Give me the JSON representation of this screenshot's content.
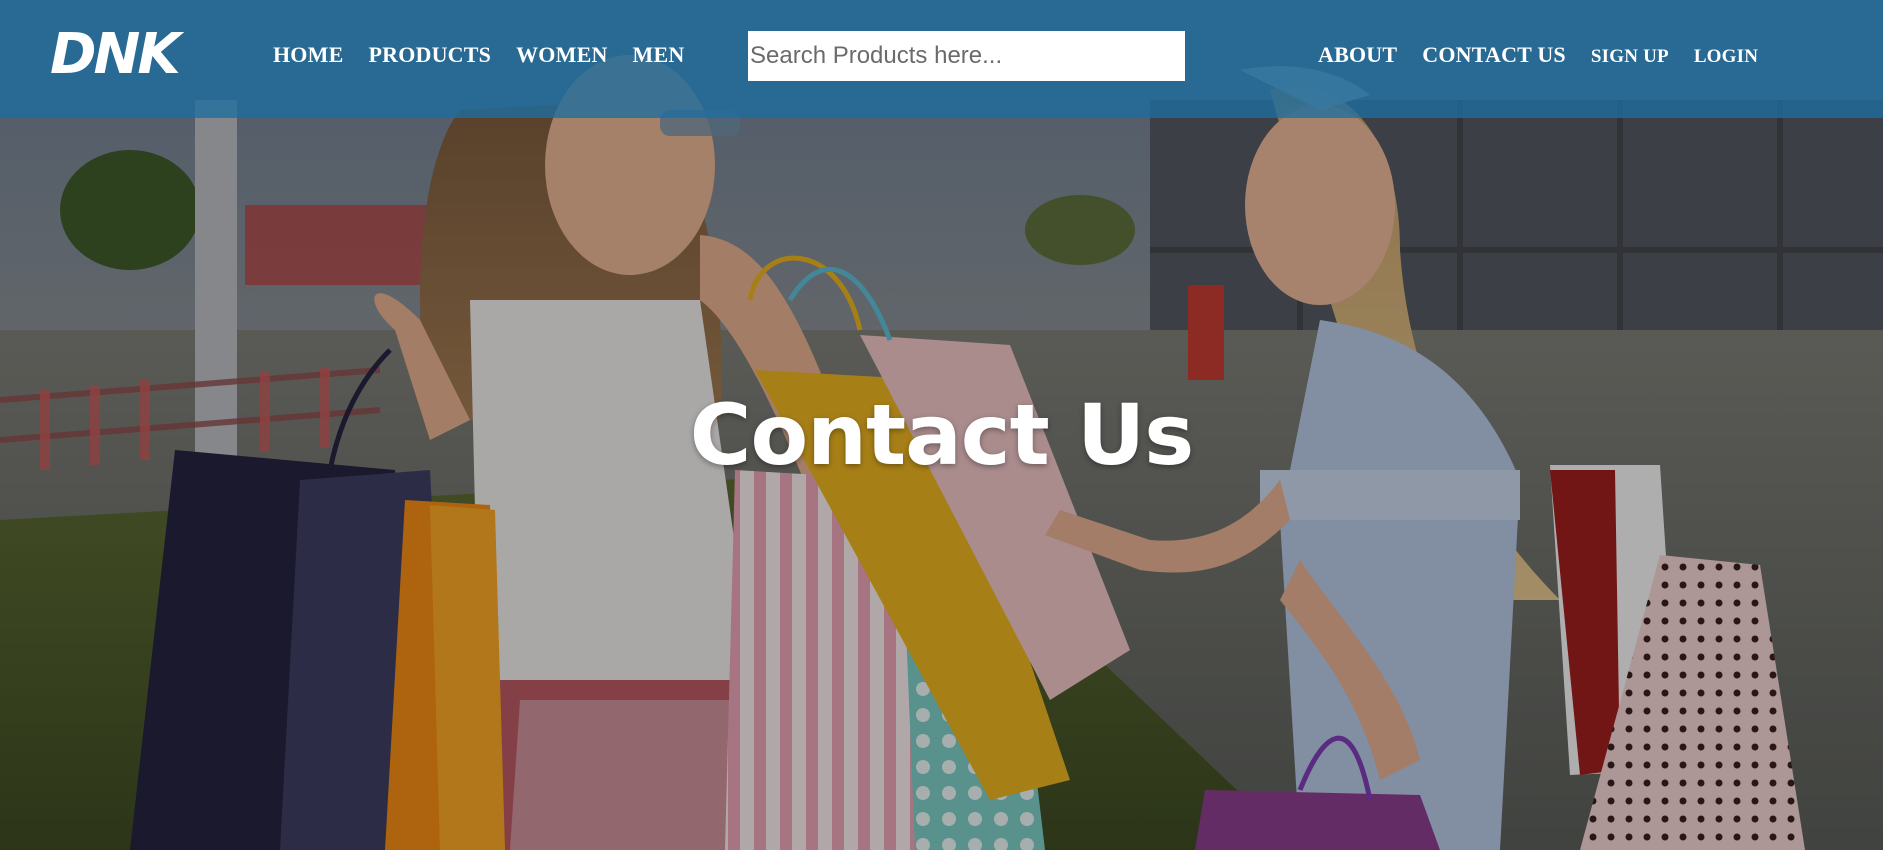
{
  "brand": {
    "logo_text": "DNK"
  },
  "nav": {
    "left": [
      {
        "label": "HOME"
      },
      {
        "label": "PRODUCTS"
      },
      {
        "label": "WOMEN"
      },
      {
        "label": "MEN"
      }
    ],
    "right": [
      {
        "label": "ABOUT"
      },
      {
        "label": "CONTACT US"
      },
      {
        "label": "SIGN UP"
      },
      {
        "label": "LOGIN"
      }
    ]
  },
  "search": {
    "placeholder": "Search Products here...",
    "value": ""
  },
  "hero": {
    "title": "Contact Us"
  },
  "colors": {
    "header": "#1e6ea0",
    "text": "#ffffff"
  }
}
